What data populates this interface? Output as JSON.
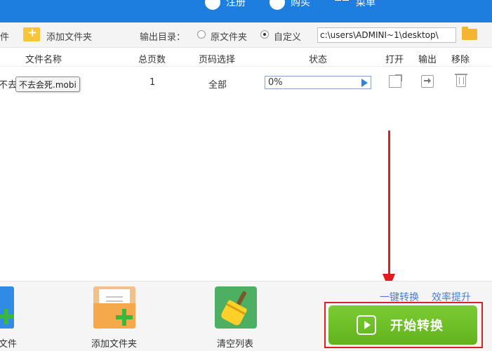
{
  "header": {
    "register_label": "注册",
    "buy_label": "购买",
    "menu_label": "菜单",
    "bg_color": "#1e7ee0"
  },
  "toolbar": {
    "add_file_label": "件",
    "add_folder_label": "添加文件夹",
    "output_dir_label": "输出目录：",
    "source_folder_label": "原文件夹",
    "custom_label": "自定义",
    "output_path": "c:\\users\\ADMINI~1\\desktop\\",
    "selected_option": "自定义"
  },
  "table": {
    "columns": [
      "文件名称",
      "总页数",
      "页码选择",
      "状态",
      "打开",
      "输出",
      "移除"
    ],
    "rows": [
      {
        "name_fragment": "不去",
        "tooltip": "不去会死.mobi",
        "pages": "1",
        "page_selection": "全部",
        "status": "0%",
        "progress": 0
      }
    ]
  },
  "bottom": {
    "add_file_label": "文件",
    "add_folder_label": "添加文件夹",
    "clear_list_label": "清空列表",
    "promo_one_click": "一键转换",
    "promo_efficiency": "效率提升",
    "start_label": "开始转换",
    "start_color": "#6cbd25",
    "highlight_color": "#e02020"
  }
}
